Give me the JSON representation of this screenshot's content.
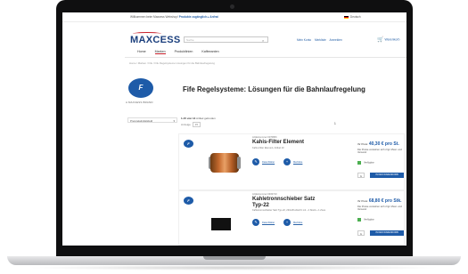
{
  "topbar": {
    "welcome": "Willkommen beim Maxcess Webshop!",
    "welcome_link": "Produkte zugänglich ▸ Anfrat",
    "language": "Deutsch"
  },
  "header": {
    "logo": "MAXCESS",
    "search_placeholder": "Suche",
    "links": [
      "Mein Konto",
      "Merkliste",
      "Anmelden"
    ],
    "cart_label": "Warenkorb"
  },
  "nav": {
    "items": [
      "Home",
      "Marken",
      "Produktlinien",
      "Kaffeeanten"
    ]
  },
  "breadcrumb": "Home  /  Marken  /  Fife  /  Fife Regelsysteme Lösungen für die Bahnlaufregelung",
  "brand": {
    "badge": "F",
    "sub": "A MAXCESS BRAND"
  },
  "page_title": "Fife Regelsysteme: Lösungen für die Bahnlaufregelung",
  "sidebar": {
    "filter_label": "Preisrelativitätsfeld"
  },
  "results": {
    "text": "Artikel gefunden",
    "count": "1-15 von 14",
    "sort_label": "Anzeige",
    "per_page": "15",
    "page": "1"
  },
  "products": [
    {
      "article": "Artikelnummer 0070806",
      "name": "Kahis-Filter Element",
      "desc": "Kahis-Filter Element, Artikel 10",
      "btn1": "Datenblätter",
      "btn2": "Merkliste",
      "price_prefix": "Ihr Preis:",
      "price": "40,30 € pro St.",
      "note": "Die Preise verstehen sich zzgl. Mwst. und Versand.",
      "stock": "Verfügbar",
      "qty": "1",
      "cart_btn": "IN DEN WARENKORB HINZUFÜGEN"
    },
    {
      "article": "Artikelnummer 0460710",
      "name": "Kahletronnschieber Satz Typ-22",
      "desc": "Kahletronnschieber Satz Typ-22, 23/12/Kuhle/1V mit - 4 Stück + 1 Zoos",
      "btn1": "Datenblätter",
      "btn2": "Merkliste",
      "price_prefix": "Ihr Preis:",
      "price": "68,80 € pro Stk.",
      "note": "Die Preise verstehen sich zzgl. Mwst. und Versand.",
      "stock": "Verfügbar",
      "qty": "1",
      "cart_btn": "IN DEN WARENKORB HINZUFÜGEN"
    }
  ],
  "colors": {
    "brand_blue": "#1e5ba8",
    "logo_navy": "#1b3f7d",
    "accent_red": "#c8202b",
    "in_stock": "#4caf50"
  }
}
